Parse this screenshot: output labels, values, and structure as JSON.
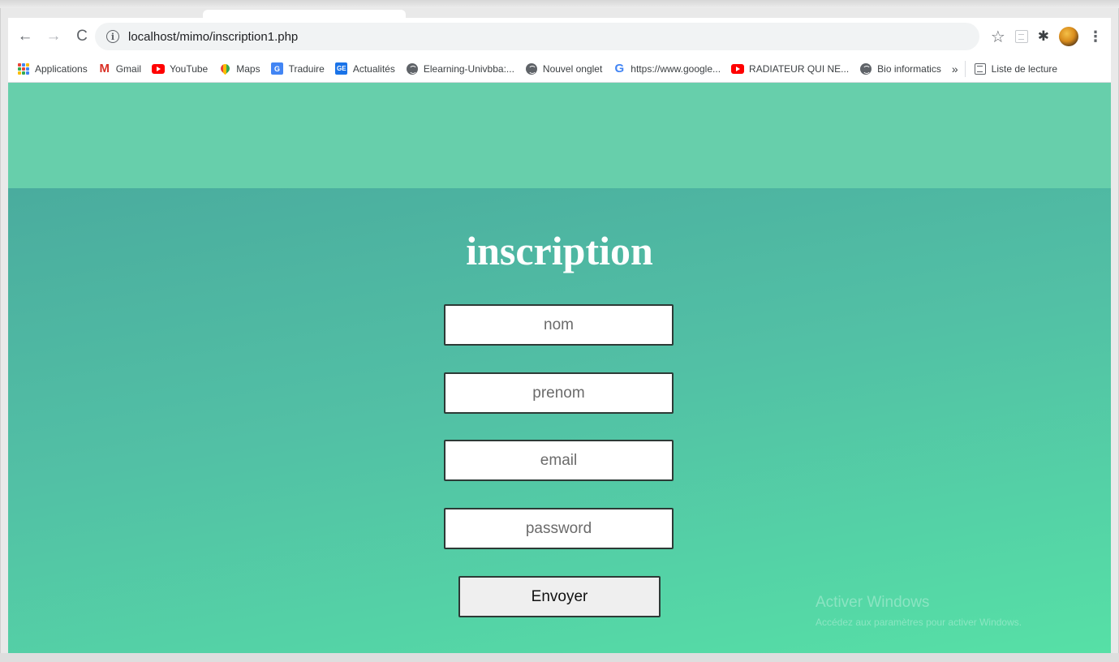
{
  "browser": {
    "url": "localhost/mimo/inscription1.php",
    "nav": {
      "back": "←",
      "forward": "→",
      "reload": "C",
      "info": "i"
    },
    "icons": {
      "star": "☆",
      "puzzle": "✱",
      "menu": "⋮"
    },
    "bookmarks": [
      {
        "label": "Applications",
        "icon": "apps-grid-icon"
      },
      {
        "label": "Gmail",
        "icon": "gmail-icon"
      },
      {
        "label": "YouTube",
        "icon": "youtube-icon"
      },
      {
        "label": "Maps",
        "icon": "maps-icon"
      },
      {
        "label": "Traduire",
        "icon": "translate-icon"
      },
      {
        "label": "Actualités",
        "icon": "news-icon"
      },
      {
        "label": "Elearning-Univbba:...",
        "icon": "globe-icon"
      },
      {
        "label": "Nouvel onglet",
        "icon": "globe-icon"
      },
      {
        "label": "https://www.google...",
        "icon": "google-icon"
      },
      {
        "label": "RADIATEUR QUI NE...",
        "icon": "youtube-icon"
      },
      {
        "label": "Bio informatics",
        "icon": "globe-icon"
      }
    ],
    "bookmarks_more": "»",
    "reading_list": "Liste de lecture",
    "icon_glyphs": {
      "gmail": "M",
      "translate": "G",
      "news": "GE",
      "google": "G"
    }
  },
  "page": {
    "title": "inscription",
    "fields": {
      "nom": "nom",
      "prenom": "prenom",
      "email": "email",
      "password": "password"
    },
    "submit_label": "Envoyer",
    "watermark": {
      "title": "Activer Windows",
      "subtitle": "Accédez aux paramètres pour activer Windows."
    }
  },
  "colors": {
    "header_band": "#67cfab",
    "gradient_start": "#4aac9e",
    "gradient_end": "#56e0a6",
    "title_text": "#ffffff"
  }
}
